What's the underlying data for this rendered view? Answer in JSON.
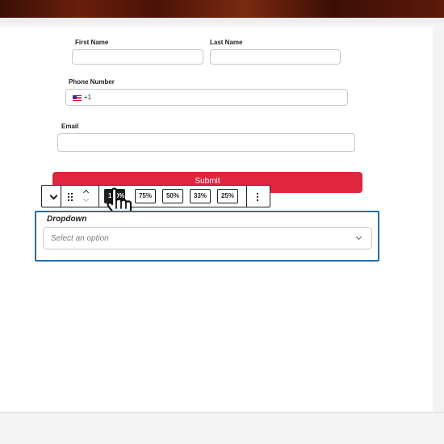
{
  "form": {
    "first_name_label": "First Name",
    "last_name_label": "Last Name",
    "phone_label": "Phone Number",
    "phone_code": "+1",
    "email_label": "Email",
    "submit_label": "Submit"
  },
  "toolbar": {
    "widths": [
      {
        "label": "100%",
        "active": true
      },
      {
        "label": "75%",
        "active": false
      },
      {
        "label": "50%",
        "active": false
      },
      {
        "label": "33%",
        "active": false
      },
      {
        "label": "25%",
        "active": false
      }
    ],
    "icons": [
      "chevron-down-icon",
      "drag-handle-icon",
      "move-up-icon",
      "move-down-icon",
      "more-options-icon"
    ]
  },
  "dropdown": {
    "label": "Dropdown",
    "placeholder": "Select an option"
  },
  "colors": {
    "submit": "#e0253f",
    "selection_outline": "#1f6fad"
  }
}
